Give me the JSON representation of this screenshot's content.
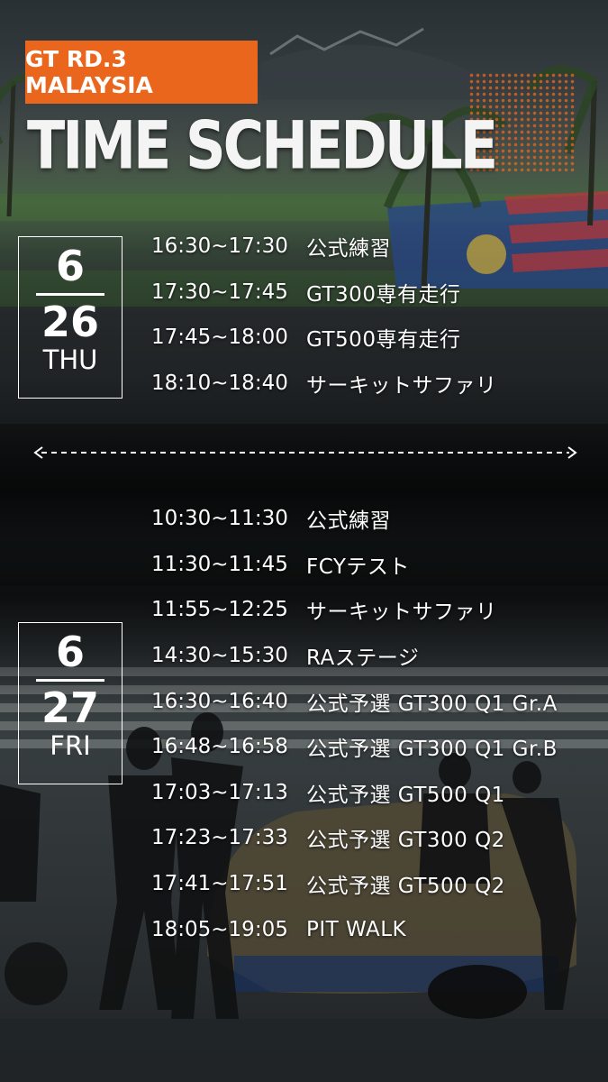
{
  "header": {
    "tag": "GT RD.3 MALAYSIA",
    "title": "TIME SCHEDULE",
    "accent_color": "#e9661c"
  },
  "day1": {
    "month": "6",
    "day": "26",
    "weekday": "THU",
    "items": [
      {
        "time": "16:30~17:30",
        "event": "公式練習"
      },
      {
        "time": "17:30~17:45",
        "event": "GT300専有走行"
      },
      {
        "time": "17:45~18:00",
        "event": "GT500専有走行"
      },
      {
        "time": "18:10~18:40",
        "event": "サーキットサファリ"
      }
    ]
  },
  "day2": {
    "month": "6",
    "day": "27",
    "weekday": "FRI",
    "items": [
      {
        "time": "10:30~11:30",
        "event": "公式練習"
      },
      {
        "time": "11:30~11:45",
        "event": "FCYテスト"
      },
      {
        "time": "11:55~12:25",
        "event": "サーキットサファリ"
      },
      {
        "time": "14:30~15:30",
        "event": "RAステージ"
      },
      {
        "time": "16:30~16:40",
        "event": "公式予選 GT300 Q1 Gr.A"
      },
      {
        "time": "16:48~16:58",
        "event": "公式予選 GT300 Q1 Gr.B"
      },
      {
        "time": "17:03~17:13",
        "event": "公式予選 GT500 Q1"
      },
      {
        "time": "17:23~17:33",
        "event": "公式予選 GT300 Q2"
      },
      {
        "time": "17:41~17:51",
        "event": "公式予選 GT500 Q2"
      },
      {
        "time": "18:05~19:05",
        "event": "PIT WALK"
      }
    ]
  },
  "divider_icon": "double-arrow-dashed-icon"
}
